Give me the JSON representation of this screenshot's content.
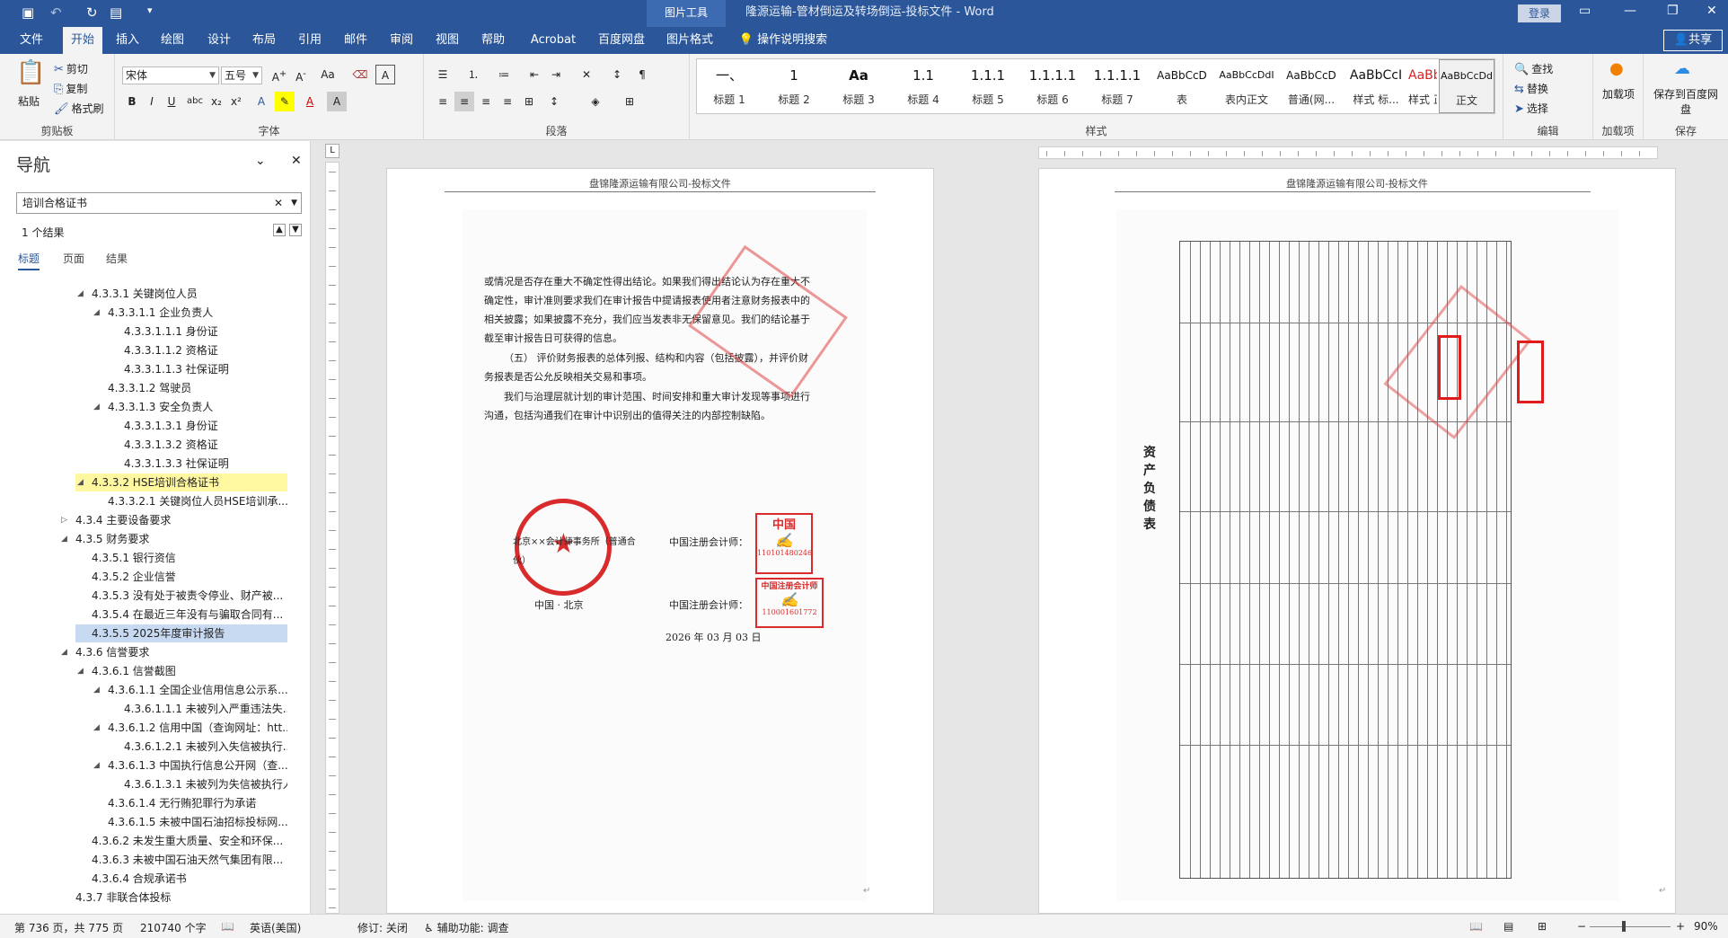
{
  "titlebar": {
    "context_tab": "图片工具",
    "document_title": "隆源运输-管材倒运及转场倒运-投标文件 - Word",
    "login": "登录",
    "share": "共享"
  },
  "tabs": [
    "文件",
    "开始",
    "插入",
    "绘图",
    "设计",
    "布局",
    "引用",
    "邮件",
    "审阅",
    "视图",
    "帮助",
    "Acrobat",
    "百度网盘",
    "图片格式",
    "操作说明搜索"
  ],
  "ribbon": {
    "clipboard": {
      "paste": "粘贴",
      "cut": "剪切",
      "copy": "复制",
      "format_painter": "格式刷",
      "label": "剪贴板"
    },
    "font": {
      "name": "宋体",
      "size": "五号",
      "label": "字体"
    },
    "paragraph": {
      "label": "段落"
    },
    "styles": {
      "label": "样式",
      "items": [
        {
          "preview": "一、",
          "name": "标题 1"
        },
        {
          "preview": "1",
          "name": "标题 2"
        },
        {
          "preview": "Aa",
          "name": "标题 3"
        },
        {
          "preview": "1.1",
          "name": "标题 4"
        },
        {
          "preview": "1.1.1",
          "name": "标题 5"
        },
        {
          "preview": "1.1.1.1",
          "name": "标题 6"
        },
        {
          "preview": "1.1.1.1",
          "name": "标题 7"
        },
        {
          "preview": "AaBbCcD",
          "name": "表"
        },
        {
          "preview": "AaBbCcDdI",
          "name": "表内正文"
        },
        {
          "preview": "AaBbCcD",
          "name": "普通(网..."
        },
        {
          "preview": "AaBbCcI",
          "name": "样式 标..."
        },
        {
          "preview": "AaBbC(",
          "name": "样式 正..."
        },
        {
          "preview": "AaBbCcDd",
          "name": "正文"
        }
      ]
    },
    "editing": {
      "find": "查找",
      "replace": "替换",
      "select": "选择",
      "label": "编辑"
    },
    "addins": {
      "btn": "加载项",
      "label": "加载项"
    },
    "save": {
      "btn": "保存到百度网盘",
      "label": "保存"
    }
  },
  "nav": {
    "title": "导航",
    "search": "培训合格证书",
    "result_count": "1 个结果",
    "tabs": [
      "标题",
      "页面",
      "结果"
    ],
    "items": [
      {
        "text": "4.3.3.1 关键岗位人员",
        "level": 4,
        "expand": "open"
      },
      {
        "text": "4.3.3.1.1 企业负责人",
        "level": 5,
        "expand": "open"
      },
      {
        "text": "4.3.3.1.1.1 身份证",
        "level": 6,
        "expand": "none"
      },
      {
        "text": "4.3.3.1.1.2 资格证",
        "level": 6,
        "expand": "none"
      },
      {
        "text": "4.3.3.1.1.3 社保证明",
        "level": 6,
        "expand": "none"
      },
      {
        "text": "4.3.3.1.2 驾驶员",
        "level": 5,
        "expand": "none"
      },
      {
        "text": "4.3.3.1.3 安全负责人",
        "level": 5,
        "expand": "open"
      },
      {
        "text": "4.3.3.1.3.1 身份证",
        "level": 6,
        "expand": "none"
      },
      {
        "text": "4.3.3.1.3.2 资格证",
        "level": 6,
        "expand": "none"
      },
      {
        "text": "4.3.3.1.3.3 社保证明",
        "level": 6,
        "expand": "none"
      },
      {
        "text": "4.3.3.2 HSE培训合格证书",
        "level": 4,
        "expand": "open",
        "highlight": "yellow"
      },
      {
        "text": "4.3.3.2.1 关键岗位人员HSE培训承...",
        "level": 5,
        "expand": "none"
      },
      {
        "text": "4.3.4 主要设备要求",
        "level": 3,
        "expand": "closed"
      },
      {
        "text": "4.3.5 财务要求",
        "level": 3,
        "expand": "open"
      },
      {
        "text": "4.3.5.1 银行资信",
        "level": 4,
        "expand": "none"
      },
      {
        "text": "4.3.5.2 企业信誉",
        "level": 4,
        "expand": "none"
      },
      {
        "text": "4.3.5.3 没有处于被责令停业、财产被...",
        "level": 4,
        "expand": "none"
      },
      {
        "text": "4.3.5.4 在最近三年没有与骗取合同有...",
        "level": 4,
        "expand": "none"
      },
      {
        "text": "4.3.5.5 2025年度审计报告",
        "level": 4,
        "expand": "none",
        "highlight": "blue"
      },
      {
        "text": "4.3.6 信誉要求",
        "level": 3,
        "expand": "open"
      },
      {
        "text": "4.3.6.1 信誉截图",
        "level": 4,
        "expand": "open"
      },
      {
        "text": "4.3.6.1.1 全国企业信用信息公示系...",
        "level": 5,
        "expand": "open"
      },
      {
        "text": "4.3.6.1.1.1 未被列入严重违法失...",
        "level": 6,
        "expand": "none"
      },
      {
        "text": "4.3.6.1.2 信用中国（查询网址：htt...",
        "level": 5,
        "expand": "open"
      },
      {
        "text": "4.3.6.1.2.1 未被列入失信被执行...",
        "level": 6,
        "expand": "none"
      },
      {
        "text": "4.3.6.1.3 中国执行信息公开网（查...",
        "level": 5,
        "expand": "open"
      },
      {
        "text": "4.3.6.1.3.1 未被列为失信被执行人",
        "level": 6,
        "expand": "none"
      },
      {
        "text": "4.3.6.1.4 无行贿犯罪行为承诺",
        "level": 5,
        "expand": "none"
      },
      {
        "text": "4.3.6.1.5 未被中国石油招标投标网...",
        "level": 5,
        "expand": "none"
      },
      {
        "text": "4.3.6.2 未发生重大质量、安全和环保...",
        "level": 4,
        "expand": "none"
      },
      {
        "text": "4.3.6.3 未被中国石油天然气集团有限...",
        "level": 4,
        "expand": "none"
      },
      {
        "text": "4.3.6.4 合规承诺书",
        "level": 4,
        "expand": "none"
      },
      {
        "text": "4.3.7 非联合体投标",
        "level": 3,
        "expand": "none"
      }
    ]
  },
  "page1": {
    "header": "盘锦隆源运输有限公司-投标文件",
    "para1": "或情况是否存在重大不确定性得出结论。如果我们得出结论认为存在重大不确定性，审计准则要求我们在审计报告中提请报表使用者注意财务报表中的相关披露；如果披露不充分，我们应当发表非无保留意见。我们的结论基于截至审计报告日可获得的信息。",
    "para2": "（五） 评价财务报表的总体列报、结构和内容（包括披露），并评价财务报表是否公允反映相关交易和事项。",
    "para3": "我们与治理层就计划的审计范围、时间安排和重大审计发现等事项进行沟通，包括沟通我们在审计中识别出的值得关注的内部控制缺陷。",
    "firm": "北京××会计师事务所（普通合伙）",
    "location": "中国 · 北京",
    "cpa_label_1": "中国注册会计师：",
    "cpa_label_2": "中国注册会计师：",
    "date": "2026 年 03 月 03 日",
    "stamp_1_top": "中国",
    "stamp_1_num": "110101480246",
    "stamp_2_top": "中国注册会计师",
    "stamp_2_num": "110001601772"
  },
  "page2": {
    "header": "盘锦隆源运输有限公司-投标文件",
    "table_title": "资 产 负 债 表"
  },
  "statusbar": {
    "page": "第 736 页，共 775 页",
    "words": "210740 个字",
    "lang": "英语(美国)",
    "track": "修订: 关闭",
    "access": "辅助功能: 调查",
    "zoom": "90%"
  }
}
